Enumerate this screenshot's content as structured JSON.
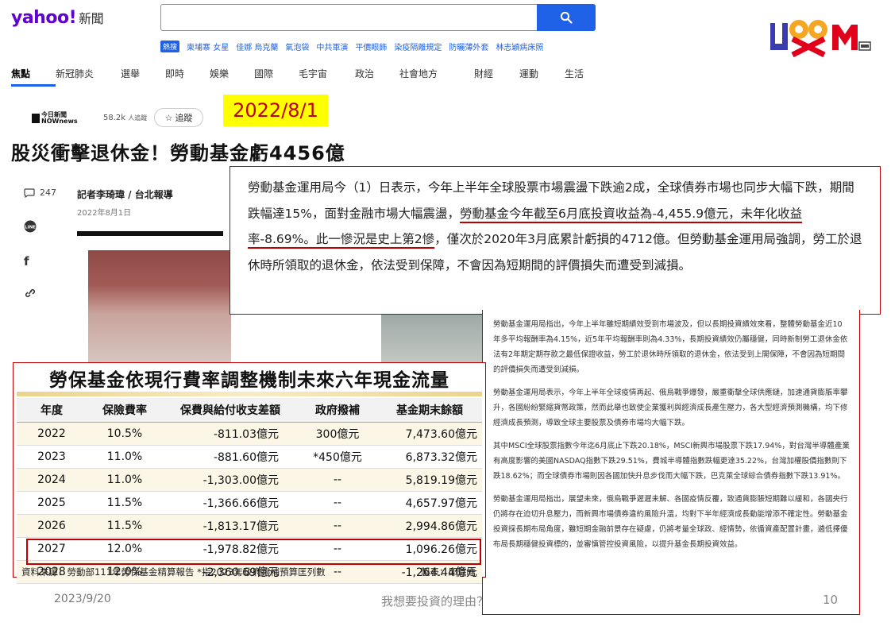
{
  "header": {
    "logo_text": "yahoo!",
    "logo_sub": "新聞",
    "search": {
      "value": "",
      "placeholder": ""
    },
    "trending_tag": "熱搜",
    "trending": [
      "柬埔寨 女星",
      "佳娜 烏克蘭",
      "氣泡袋",
      "中共軍演",
      "平價眼飾",
      "染疫隔離規定",
      "防曬薄外套",
      "林志穎病床照"
    ],
    "brand_letters": "L◎◎K M"
  },
  "nav": [
    "焦點",
    "新冠肺炎",
    "選舉",
    "即時",
    "娛樂",
    "國際",
    "毛宇宙",
    "政治",
    "社會地方",
    "財經",
    "運動",
    "生活"
  ],
  "publisher": {
    "name": "今日新聞",
    "name_en": "NOWnews",
    "followers": "58.2k",
    "followers_label": "人追蹤",
    "follow_label": "追蹤"
  },
  "date_badge": "2022/8/1",
  "headline": "股災衝擊退休金！勞動基金虧4456億",
  "sidebar": {
    "comments": "247"
  },
  "byline": "記者李琦瑋 / 台北報導",
  "pub_date": "2022年8月1日",
  "quote": {
    "p1": "勞動基金運用局今（1）日表示，今年上半年全球股票市場震盪下跌逾2成，全球債券市場也同步大幅下跌，期間跌幅達15%，面對金融市場大幅震盪，",
    "p2_underlined": "勞動基金今年截至6月底投資收益為-4,455.9億元，未年化收益率-8.69%。此一慘況是史上第2慘",
    "p3": "，僅次於2020年3月底累計虧損的4712億。但勞動基金運用局強調，勞工於退休時所領取的退休金，依法受到保障，不會因為短期間的評價損失而遭受到減損。"
  },
  "table": {
    "title": "勞保基金依現行費率調整機制未來六年現金流量",
    "headers": [
      "年度",
      "保險費率",
      "保費與給付收支差額",
      "政府撥補",
      "基金期末餘額"
    ],
    "rows": [
      [
        "2022",
        "10.5%",
        "-811.03億元",
        "300億元",
        "7,473.60億元"
      ],
      [
        "2023",
        "11.0%",
        "-881.60億元",
        "*450億元",
        "6,873.32億元"
      ],
      [
        "2024",
        "11.0%",
        "-1,303.00億元",
        "--",
        "5,819.19億元"
      ],
      [
        "2025",
        "11.5%",
        "-1,366.66億元",
        "--",
        "4,657.97億元"
      ],
      [
        "2026",
        "11.5%",
        "-1,813.17億元",
        "--",
        "2,994.86億元"
      ],
      [
        "2027",
        "12.0%",
        "-1,978.82億元",
        "--",
        "1,096.26億元"
      ],
      [
        "2028",
        "12.0%",
        "-2,360.69億元",
        "--",
        "-1,264.44億元"
      ]
    ],
    "source": "資料來源：勞動部111年勞保基金精算報告 *指2023年政府撥補預算匡列數",
    "maker": "製表：邱琮皓"
  },
  "article": [
    "勞動基金運用局指出，今年上半年雖短期績效受到市場波及，但以長期投資績效來看，整體勞動基金近10年多平均報酬率為4.15%，近5年平均報酬率則為4.33%，長期投資績效仍屬穩健，同時新制勞工退休金依法有2年期定期存款之最低保證收益，勞工於退休時所領取的退休金，依法受到上開保障，不會因為短期間的評價損失而遭受到減損。",
    "勞動基金運用局表示，今年上半年全球疫情再起、俄烏戰爭爆發，嚴重衝擊全球供應鏈，加速通貨膨脹率攀升，各國紛紛緊縮貨幣政策，然而此舉也致使企業獲利與經濟成長產生壓力，各大型經濟預測機構，均下修經濟成長預測，導致全球主要股票及債券市場均大幅下跌。",
    "其中MSCI全球股票指數今年迄6月底止下跌20.18%，MSCI新興市場股票下跌17.94%，對台灣半導體產業有高度影響的美國NASDAQ指數下跌29.51%，費城半導體指數跌幅更達35.22%，台灣加權股價指數則下跌18.62%；而全球債券市場則因各國加快升息步伐而大幅下跌，巴克萊全球綜合債券指數下跌13.91%。",
    "勞動基金運用局指出，展望未來，俄烏戰爭遲遲未解、各國疫情反覆，致通貨膨脹短期難以緩和，各國央行仍將存在迫切升息壓力，而新興市場債券違約風險升溫，均對下半年經濟成長動能增添不確定性。勞動基金投資採長期布局角度，雖短期金融前景存在疑慮，仍將考量全球政、經情勢，依循資產配置計畫，遴低擇優布局長期穩健投資標的，並審慎管控投資風險，以提升基金長期投資效益。"
  ],
  "footer": {
    "date": "2023/9/20",
    "title": "我想要投資的理由？",
    "page": "10"
  },
  "colors": {
    "accent": "#1f62e8",
    "brand_purple": "#6001d2",
    "highlight_red": "#c00000",
    "badge_yellow": "#ffff00"
  }
}
